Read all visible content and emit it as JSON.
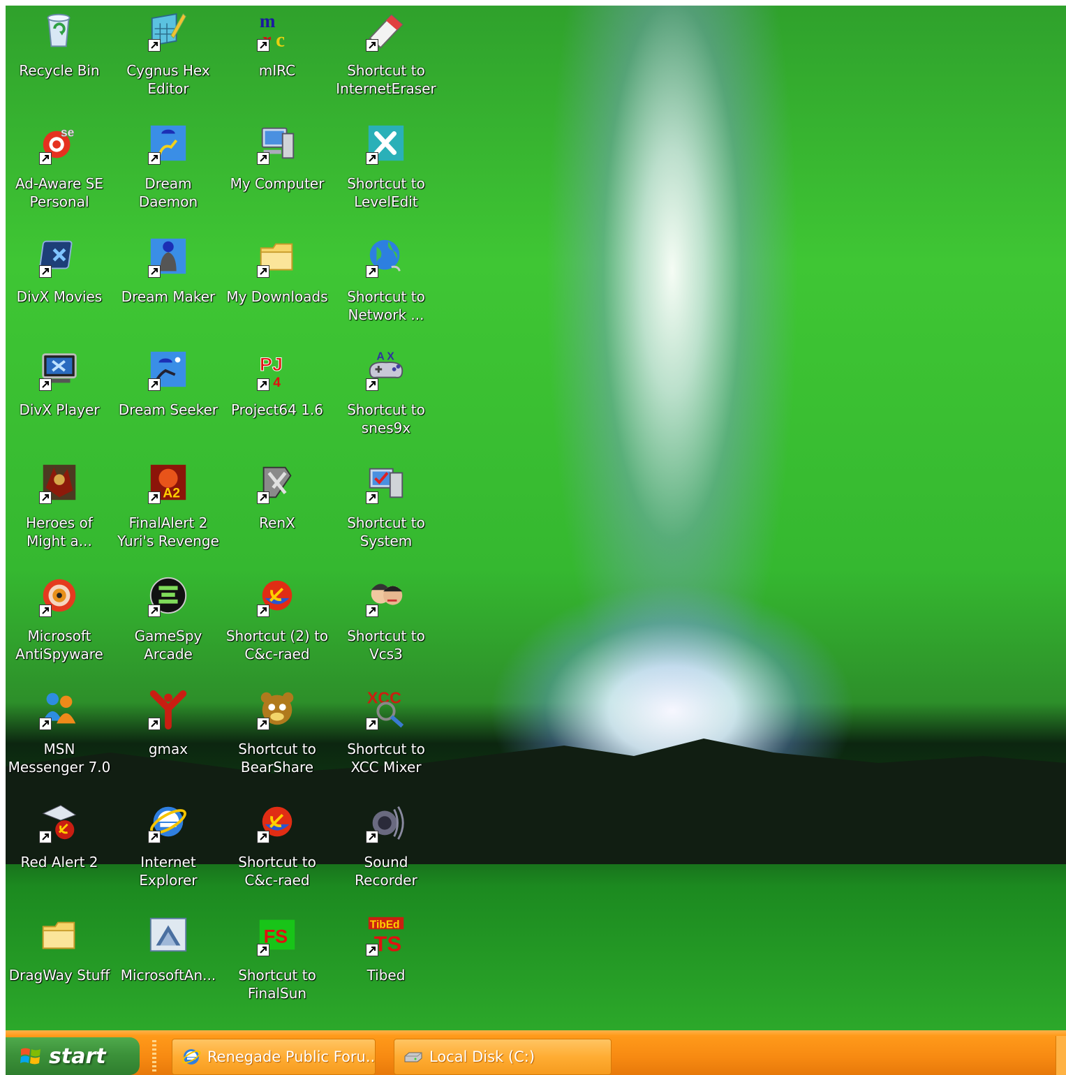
{
  "desktop": {
    "icons": [
      {
        "label": "Recycle Bin",
        "icon": "recycle-bin-icon",
        "shortcut": false
      },
      {
        "label": "Ad-Aware SE\nPersonal",
        "icon": "ad-aware-icon",
        "shortcut": true
      },
      {
        "label": "DivX Movies",
        "icon": "divx-movies-icon",
        "shortcut": true
      },
      {
        "label": "DivX Player",
        "icon": "divx-player-icon",
        "shortcut": true
      },
      {
        "label": "Heroes of\nMight a...",
        "icon": "heroes-icon",
        "shortcut": true
      },
      {
        "label": "Microsoft\nAntiSpyware",
        "icon": "antispyware-icon",
        "shortcut": true
      },
      {
        "label": "MSN\nMessenger 7.0",
        "icon": "msn-messenger-icon",
        "shortcut": true
      },
      {
        "label": "Red Alert 2",
        "icon": "red-alert-icon",
        "shortcut": true
      },
      {
        "label": "DragWay Stuff",
        "icon": "folder-icon",
        "shortcut": false
      },
      {
        "label": "Cygnus Hex\nEditor",
        "icon": "hex-editor-icon",
        "shortcut": true
      },
      {
        "label": "Dream Daemon",
        "icon": "dream-daemon-icon",
        "shortcut": true
      },
      {
        "label": "Dream Maker",
        "icon": "dream-maker-icon",
        "shortcut": true
      },
      {
        "label": "Dream Seeker",
        "icon": "dream-seeker-icon",
        "shortcut": true
      },
      {
        "label": "FinalAlert 2\nYuri's Revenge",
        "icon": "finalalert-icon",
        "shortcut": true
      },
      {
        "label": "GameSpy\nArcade",
        "icon": "gamespy-icon",
        "shortcut": true
      },
      {
        "label": "gmax",
        "icon": "gmax-icon",
        "shortcut": true
      },
      {
        "label": "Internet\nExplorer",
        "icon": "internet-explorer-icon",
        "shortcut": true
      },
      {
        "label": "MicrosoftAn...",
        "icon": "microsoft-an-icon",
        "shortcut": false
      },
      {
        "label": "mIRC",
        "icon": "mirc-icon",
        "shortcut": true
      },
      {
        "label": "My Computer",
        "icon": "my-computer-icon",
        "shortcut": true
      },
      {
        "label": "My Downloads",
        "icon": "folder-icon",
        "shortcut": true
      },
      {
        "label": "Project64 1.6",
        "icon": "project64-icon",
        "shortcut": true
      },
      {
        "label": "RenX",
        "icon": "renx-icon",
        "shortcut": true
      },
      {
        "label": "Shortcut (2) to\nC&c-raed",
        "icon": "cnc-raed-icon",
        "shortcut": true
      },
      {
        "label": "Shortcut to\nBearShare",
        "icon": "bearshare-icon",
        "shortcut": true
      },
      {
        "label": "Shortcut to\nC&c-raed",
        "icon": "cnc-raed-icon",
        "shortcut": true
      },
      {
        "label": "Shortcut to\nFinalSun",
        "icon": "finalsun-icon",
        "shortcut": true
      },
      {
        "label": "Shortcut to\nInternetEraser",
        "icon": "eraser-icon",
        "shortcut": true
      },
      {
        "label": "Shortcut to\nLevelEdit",
        "icon": "leveledit-tools-icon",
        "shortcut": true
      },
      {
        "label": "Shortcut to\nNetwork ...",
        "icon": "network-globe-icon",
        "shortcut": true
      },
      {
        "label": "Shortcut to\nsnes9x",
        "icon": "snes9x-gamepad-icon",
        "shortcut": true
      },
      {
        "label": "Shortcut to\nSystem",
        "icon": "system-icon",
        "shortcut": true
      },
      {
        "label": "Shortcut to\nVcs3",
        "icon": "vcs3-faces-icon",
        "shortcut": true
      },
      {
        "label": "Shortcut to\nXCC Mixer",
        "icon": "xcc-mixer-icon",
        "shortcut": true
      },
      {
        "label": "Sound\nRecorder",
        "icon": "sound-recorder-icon",
        "shortcut": true
      },
      {
        "label": "Tibed",
        "icon": "tibed-icon",
        "shortcut": true
      }
    ]
  },
  "taskbar": {
    "start_label": "start",
    "buttons": [
      {
        "label": "Renegade Public Foru...",
        "icon": "internet-explorer-icon"
      },
      {
        "label": "Local Disk (C:)",
        "icon": "disk-drive-icon"
      }
    ]
  }
}
